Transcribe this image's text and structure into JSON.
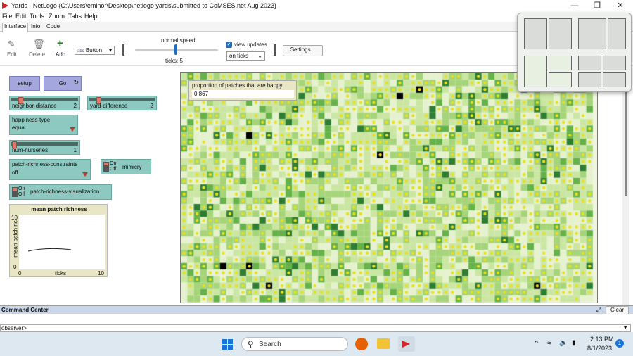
{
  "window": {
    "title": "Yards - NetLogo {C:\\Users\\eminor\\Desktop\\netlogo yards\\submitted to CoMSES.net Aug 2023}",
    "controls": [
      "minimize",
      "maximize",
      "close"
    ]
  },
  "menu": [
    "File",
    "Edit",
    "Tools",
    "Zoom",
    "Tabs",
    "Help"
  ],
  "tabs": [
    "Interface",
    "Info",
    "Code"
  ],
  "toolbar": {
    "edit": "Edit",
    "delete": "Delete",
    "add": "Add",
    "widget_type": "Button",
    "speed_label": "normal speed",
    "ticks_label": "ticks: 5",
    "view_updates": "view updates",
    "view_updates_checked": true,
    "update_mode": "on ticks",
    "settings": "Settings..."
  },
  "widgets": {
    "setup": "setup",
    "go": "Go",
    "neighbor_distance": {
      "label": "neighbor-distance",
      "value": "2",
      "fraction": 0.1
    },
    "yard_difference": {
      "label": "yard-difference",
      "value": "2",
      "fraction": 0.1
    },
    "happiness_type": {
      "label": "happiness-type",
      "value": "equal"
    },
    "num_nurseries": {
      "label": "num-nurseries",
      "value": "1",
      "fraction": 0.05
    },
    "patch_richness_constraints": {
      "label": "patch-richness-constraints",
      "value": "off"
    },
    "mimicry": {
      "label": "mimicry",
      "on": "On",
      "off": "Off"
    },
    "patch_richness_visualization": {
      "label": "patch-richness-visualization",
      "on": "On",
      "off": "Off"
    }
  },
  "plot": {
    "title": "mean patch richness",
    "ylabel": "mean patch ric",
    "xlabel": "ticks",
    "xmin": "0",
    "xmax": "10",
    "ymin": "0",
    "ymax": "10"
  },
  "monitor": {
    "label": "proportion of patches that are happy",
    "value": "0.867"
  },
  "command_center": {
    "title": "Command Center",
    "clear": "Clear",
    "prompt": "observer>"
  },
  "taskbar": {
    "search": "Search",
    "time": "2:13 PM",
    "date": "8/1/2023",
    "notifications": "1"
  },
  "colors": {
    "accent_button": "#a3a7dd",
    "widget_teal": "#8ec9c1",
    "patch_green": "#2e8b2e",
    "turtle_yellow": "#e8e020"
  }
}
